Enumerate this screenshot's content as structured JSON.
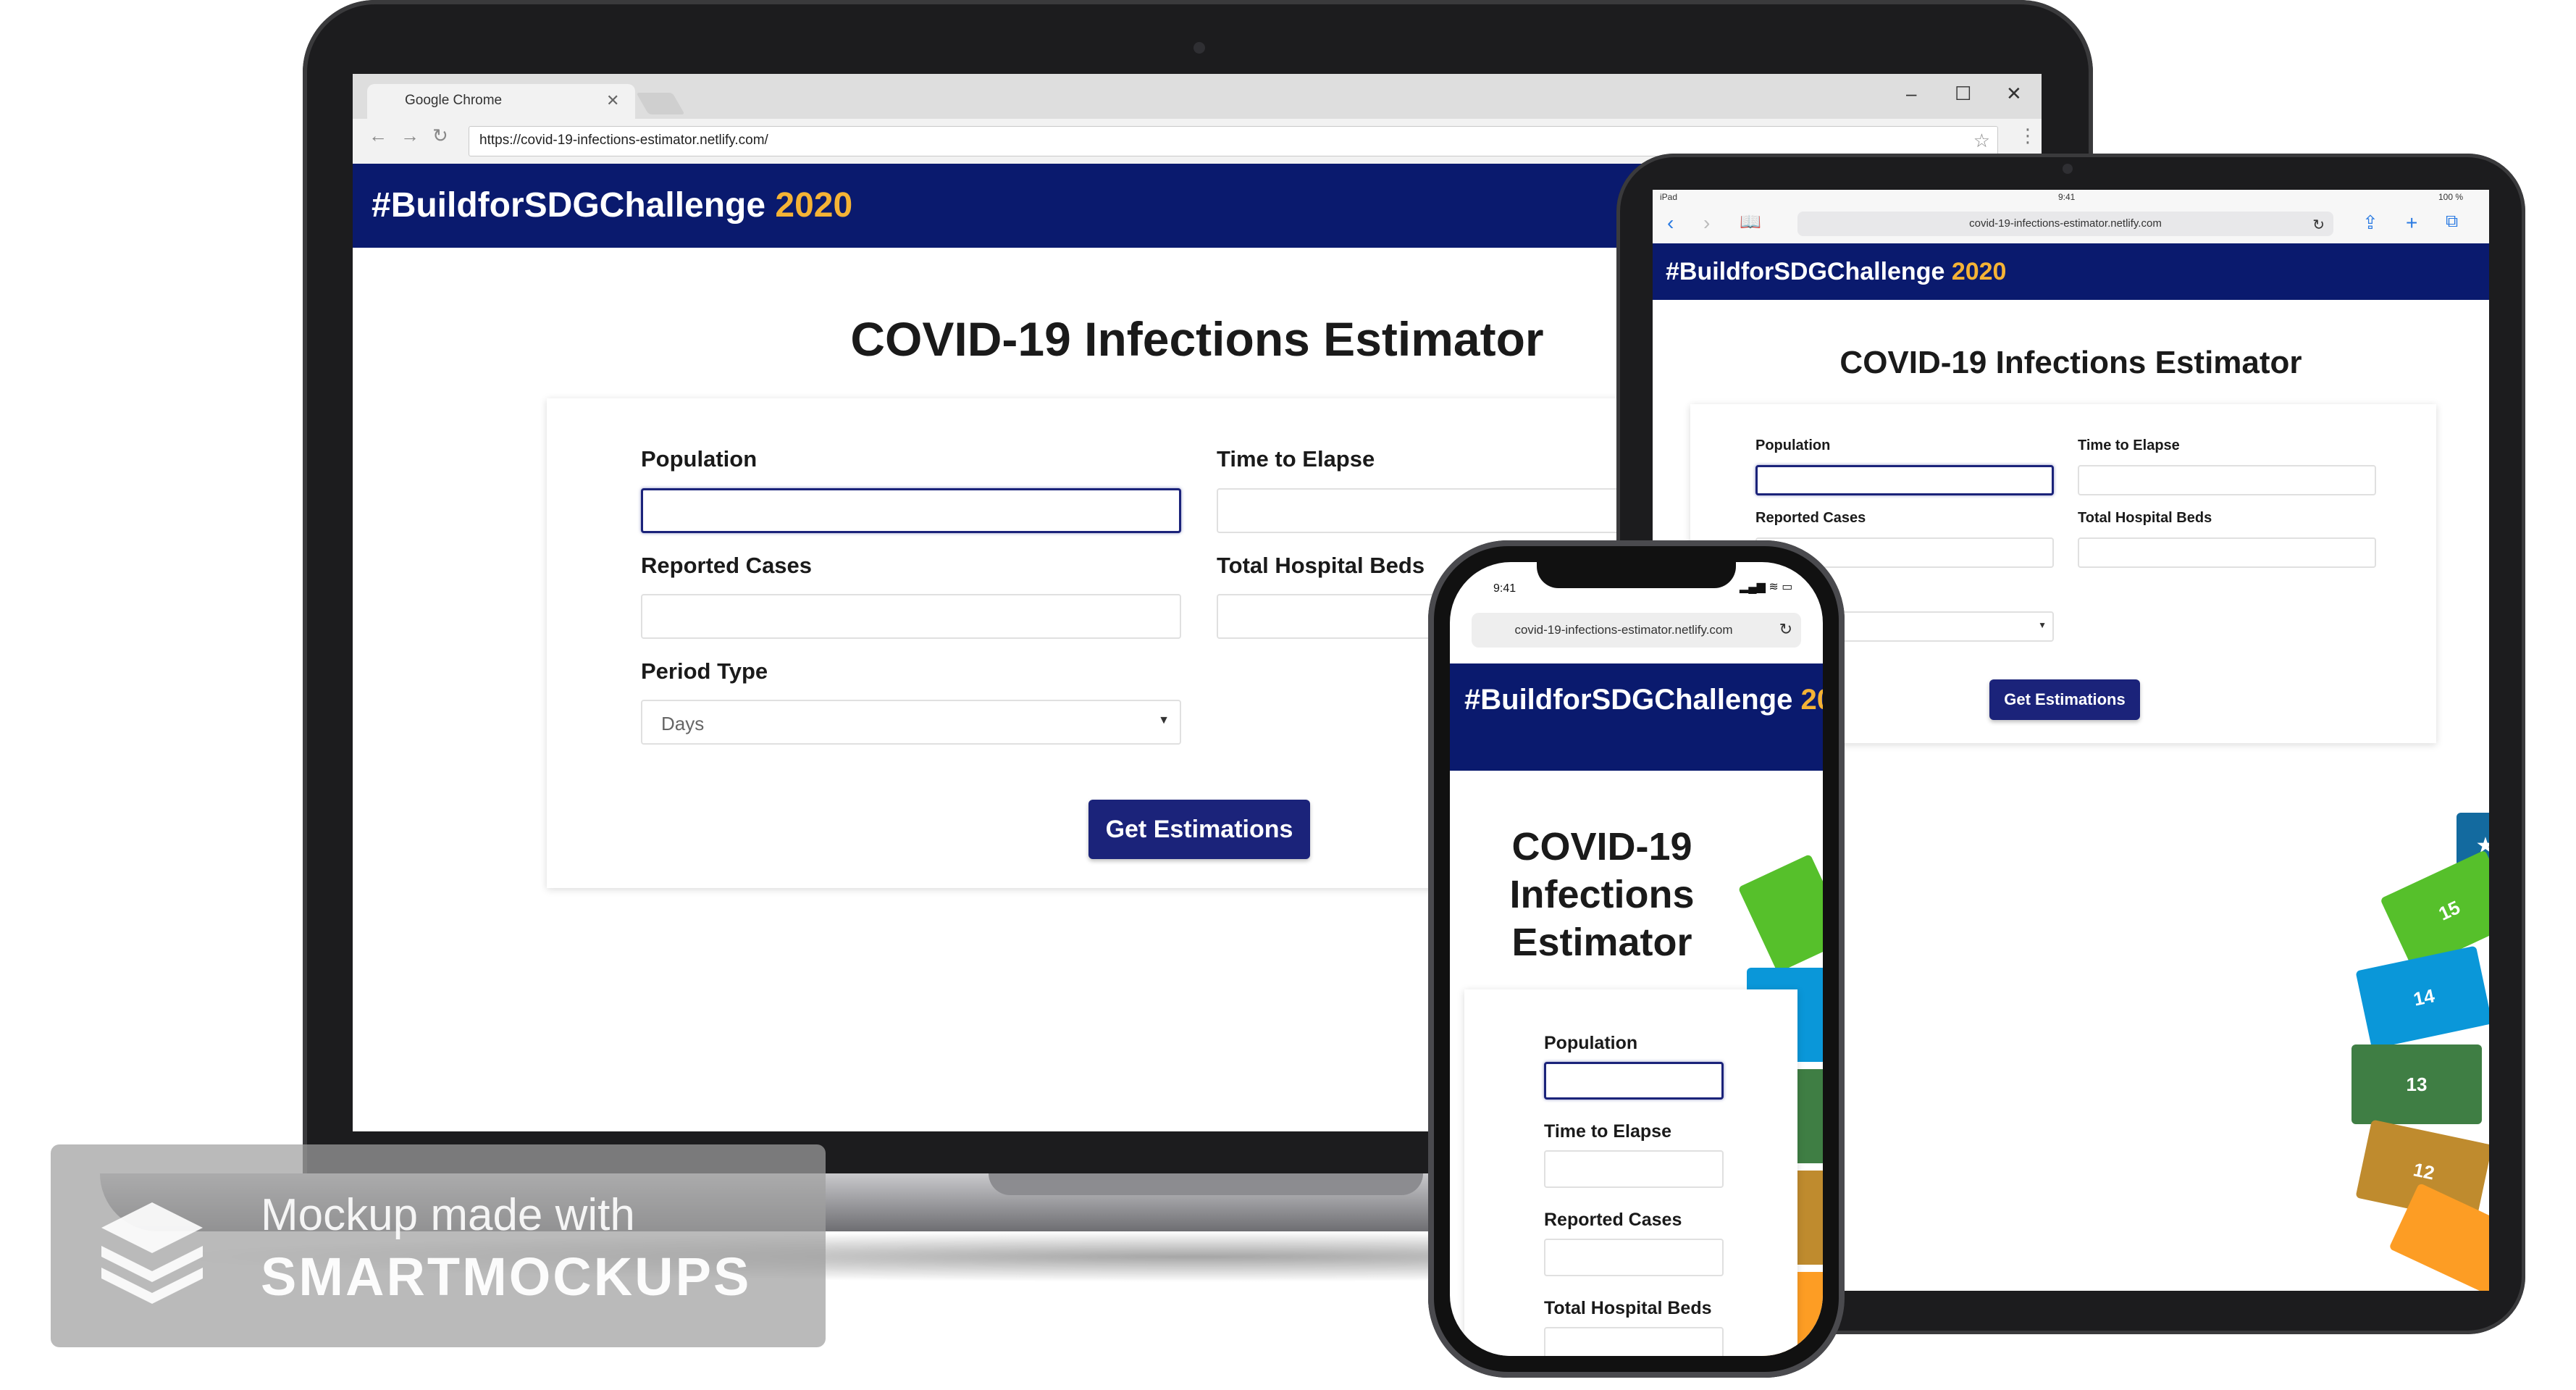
{
  "browser": {
    "tab_title": "Google Chrome",
    "url": "https://covid-19-infections-estimator.netlify.com/",
    "short_url": "covid-19-infections-estimator.netlify.com"
  },
  "header": {
    "brand": "#BuildforSDGChallenge",
    "year": "2020",
    "phone_year": "20"
  },
  "page": {
    "title": "COVID-19 Infections Estimator",
    "phone_title_lines": [
      "COVID-19",
      "Infections",
      "Estimator"
    ]
  },
  "form": {
    "population_label": "Population",
    "time_to_elapse_label": "Time to Elapse",
    "reported_cases_label": "Reported Cases",
    "total_hospital_beds_label": "Total Hospital Beds",
    "period_type_label": "Period Type",
    "period_type_value": "Days",
    "submit_label": "Get Estimations"
  },
  "ipad_status": {
    "device": "iPad",
    "time": "9:41",
    "battery": "100 %"
  },
  "phone_status": {
    "time": "9:41"
  },
  "sdg_numbers": [
    "15",
    "14",
    "13",
    "12"
  ],
  "watermark": {
    "line1": "Mockup made with",
    "line2": "SMARTMOCKUPS"
  },
  "colors": {
    "header_bg": "#0a1a6e",
    "year_accent": "#f5b335",
    "button_bg": "#1b237a"
  }
}
